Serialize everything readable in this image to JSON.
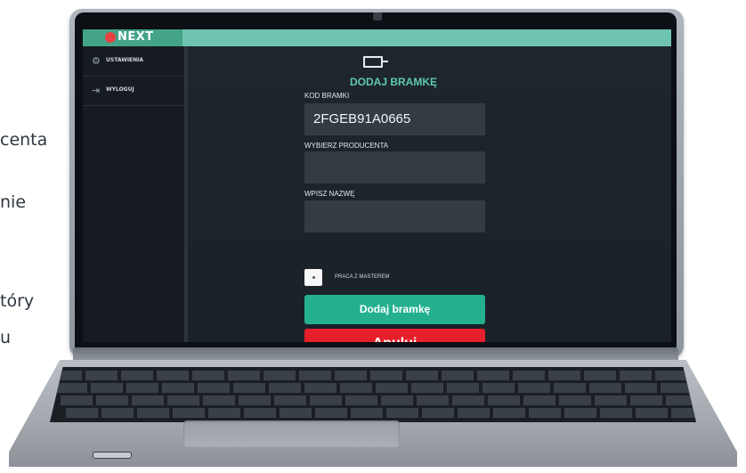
{
  "background_text": [
    "centa",
    "nie",
    "tóry",
    "u"
  ],
  "app": {
    "logo": "NEXT"
  },
  "sidebar": {
    "items": [
      {
        "label": "USTAWIENIA",
        "icon": "gear-icon"
      },
      {
        "label": "WYLOGUJ",
        "icon": "logout-icon"
      }
    ]
  },
  "form": {
    "icon": "gateway-icon",
    "title": "DODAJ BRAMKĘ",
    "code_label": "KOD BRAMKI",
    "code_value": "2FGEB91A0665",
    "producer_label": "WYBIERZ PRODUCENTA",
    "producer_value": "",
    "name_label": "WPISZ NAZWĘ",
    "name_value": "",
    "master_label": "PRACA Z MASTEREM",
    "add_button": "Dodaj bramkę",
    "cancel_button": "Anuluj"
  },
  "colors": {
    "accent": "#24b08f",
    "cancel": "#e61f2b",
    "topbar": "#6fc4b0"
  }
}
